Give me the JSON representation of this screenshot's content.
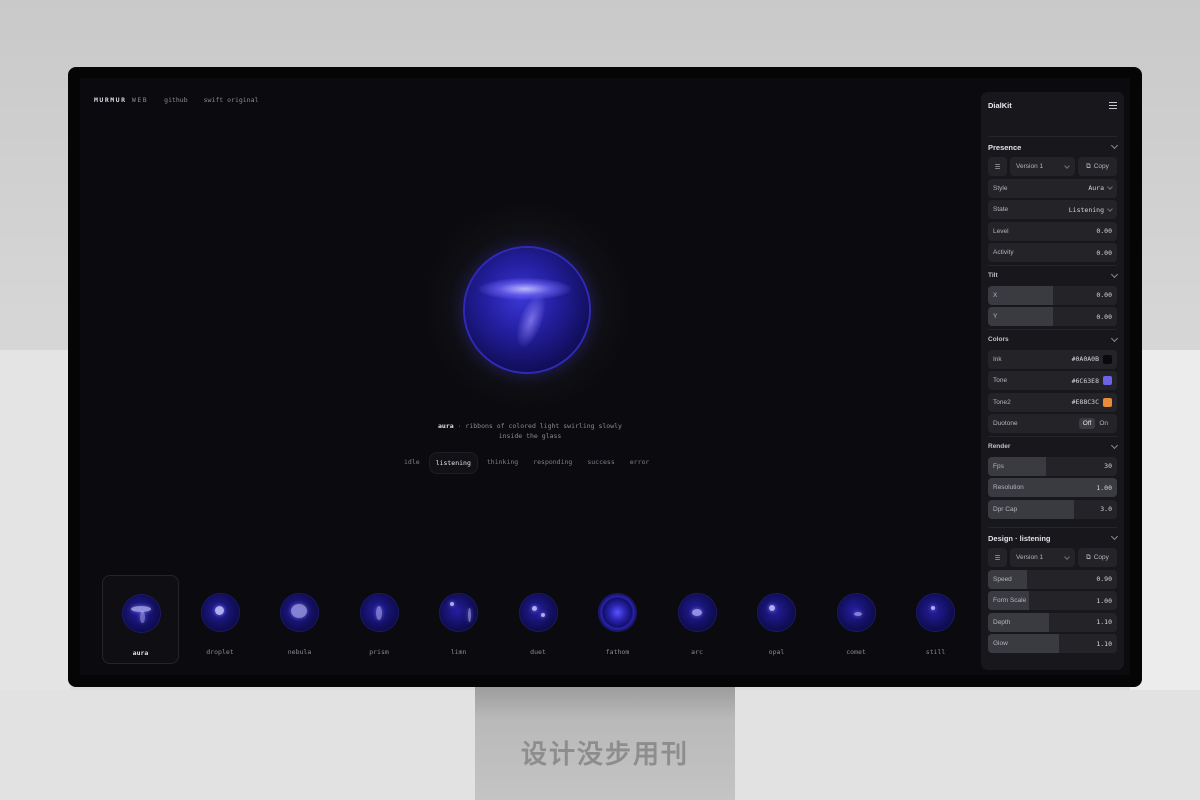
{
  "stand_logo": "设计没步用刊",
  "nav": {
    "brand": "MURMUR",
    "brand_suffix": "WEB",
    "links": [
      "github",
      "swift original"
    ]
  },
  "hero": {
    "name": "aura",
    "description_line1": "· ribbons of colored light swirling slowly",
    "description_line2": "inside the glass"
  },
  "states": {
    "items": [
      "idle",
      "listening",
      "thinking",
      "responding",
      "success",
      "error"
    ],
    "active": "listening"
  },
  "gallery": {
    "items": [
      "aura",
      "droplet",
      "nebula",
      "prism",
      "limn",
      "duet",
      "fathom",
      "arc",
      "opal",
      "comet",
      "still"
    ],
    "active": "aura"
  },
  "panel": {
    "title": "DialKit",
    "presence": {
      "title": "Presence",
      "version": "Version 1",
      "copy": "Copy",
      "style": {
        "label": "Style",
        "value": "Aura"
      },
      "state": {
        "label": "State",
        "value": "Listening"
      },
      "level": {
        "label": "Level",
        "value": "0.00"
      },
      "activity": {
        "label": "Activity",
        "value": "0.00"
      }
    },
    "tilt": {
      "title": "Tilt",
      "x": {
        "label": "X",
        "value": "0.00",
        "fill": 0.5
      },
      "y": {
        "label": "Y",
        "value": "0.00",
        "fill": 0.5
      }
    },
    "colors": {
      "title": "Colors",
      "ink": {
        "label": "Ink",
        "value": "#0A0A0B",
        "color": "#0A0A0B"
      },
      "tone": {
        "label": "Tone",
        "value": "#6C63E8",
        "color": "#6C63E8"
      },
      "tone2": {
        "label": "Tone2",
        "value": "#E88C3C",
        "color": "#E88C3C"
      },
      "duotone": {
        "label": "Duotone",
        "off": "Off",
        "on": "On",
        "selected": "Off"
      }
    },
    "render": {
      "title": "Render",
      "fps": {
        "label": "Fps",
        "value": "30",
        "fill": 0.45
      },
      "resolution": {
        "label": "Resolution",
        "value": "1.00",
        "fill": 1.0
      },
      "dpr": {
        "label": "Dpr Cap",
        "value": "3.0",
        "fill": 0.67
      }
    },
    "design": {
      "title": "Design · listening",
      "version": "Version 1",
      "copy": "Copy",
      "speed": {
        "label": "Speed",
        "value": "0.90",
        "fill": 0.3
      },
      "form_scale": {
        "label": "Form Scale",
        "value": "1.00",
        "fill": 0.32
      },
      "depth": {
        "label": "Depth",
        "value": "1.10",
        "fill": 0.47
      },
      "glow": {
        "label": "Glow",
        "value": "1.10",
        "fill": 0.55
      }
    }
  }
}
